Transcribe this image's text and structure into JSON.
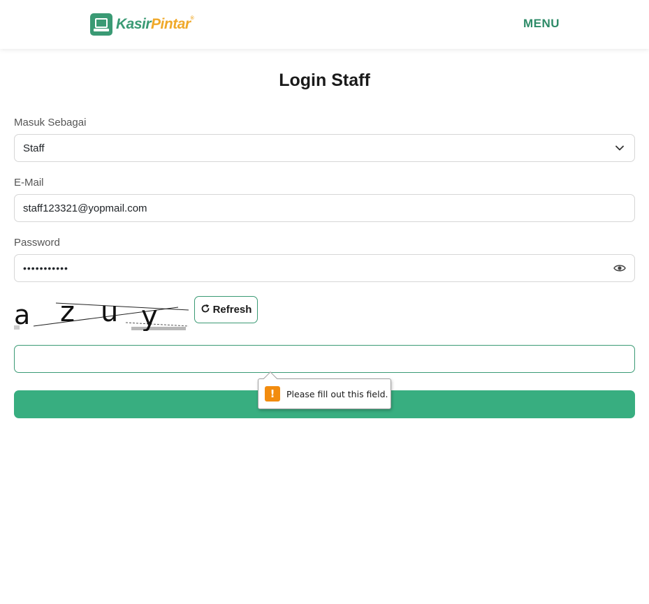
{
  "brand": {
    "name_part1": "Kasir",
    "name_part2": "Pintar",
    "reg_mark": "®"
  },
  "nav": {
    "menu_label": "MENU"
  },
  "page": {
    "title": "Login Staff"
  },
  "form": {
    "role": {
      "label": "Masuk Sebagai",
      "value": "Staff"
    },
    "email": {
      "label": "E-Mail",
      "value": "staff123321@yopmail.com"
    },
    "password": {
      "label": "Password",
      "masked_value": "•••••••••••"
    },
    "captcha": {
      "text": "azuy",
      "refresh_label": "Refresh",
      "input_value": ""
    },
    "submit_label": ""
  },
  "validation_tooltip": {
    "message": "Please fill out this field."
  },
  "colors": {
    "primary": "#38ae80",
    "brand_green": "#3a9a74",
    "brand_orange": "#f0a92a",
    "warning": "#f28c0f"
  },
  "icons": {
    "role_select": "chevron-down-icon",
    "password_toggle": "eye-icon",
    "refresh": "refresh-icon",
    "warning": "warning-icon"
  }
}
